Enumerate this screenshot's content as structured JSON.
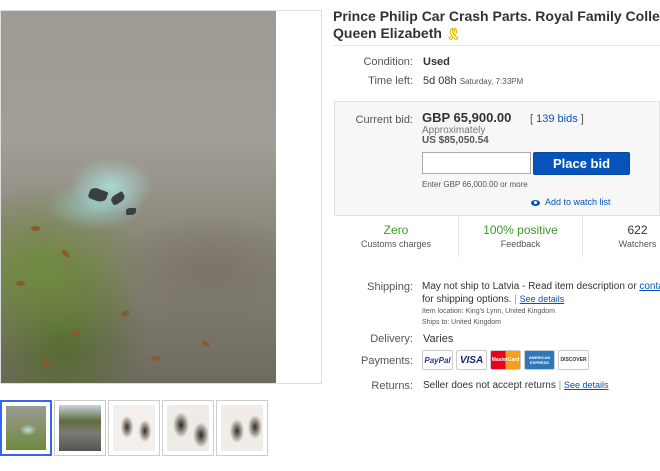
{
  "listing": {
    "title_line1": "Prince Philip Car Crash Parts. Royal Family Collect",
    "title_line2": "Queen Elizabeth",
    "ribbon_icon": "awareness-ribbon-icon"
  },
  "details": {
    "condition_label": "Condition:",
    "condition_value": "Used",
    "time_left_label": "Time left:",
    "time_left_value": "5d 08h",
    "time_left_when": "Saturday, 7:33PM"
  },
  "bid": {
    "current_bid_label": "Current bid:",
    "amount": "GBP 65,900.00",
    "approximately": "Approximately",
    "usd": "US $85,050.54",
    "bids_open": "[",
    "bids_link": "139 bids",
    "bids_close": "]",
    "input_value": "",
    "place_bid_label": "Place bid",
    "enter_hint": "Enter GBP 66,000.00 or more",
    "watch_label": "Add to watch list"
  },
  "stats": [
    {
      "big": "Zero",
      "small": "Customs charges",
      "color": "#3a9b2a"
    },
    {
      "big": "100% positive",
      "small": "Feedback",
      "color": "#3a9b2a"
    },
    {
      "big": "622",
      "small": "Watchers",
      "color": "#333333"
    }
  ],
  "shipping": {
    "label": "Shipping:",
    "line1_text": "May not ship to Latvia - Read item description or ",
    "line1_link": "contac",
    "line2_text": "for shipping options.",
    "line2_sep": " | ",
    "line2_link": "See details",
    "location": "Item location:  King's Lynn, United Kingdom",
    "ships_to": "Ships to:  United Kingdom"
  },
  "delivery": {
    "label": "Delivery:",
    "value": "Varies"
  },
  "payments": {
    "label": "Payments:",
    "methods": [
      "PayPal",
      "VISA",
      "MasterCard",
      "AMERICAN EXPRESS",
      "DISCOVER"
    ]
  },
  "returns": {
    "label": "Returns:",
    "value": "Seller does not accept returns",
    "sep": " | ",
    "link": "See details"
  },
  "colors": {
    "link": "#0654ba",
    "button": "#0654ba",
    "positive": "#3a9b2a"
  }
}
